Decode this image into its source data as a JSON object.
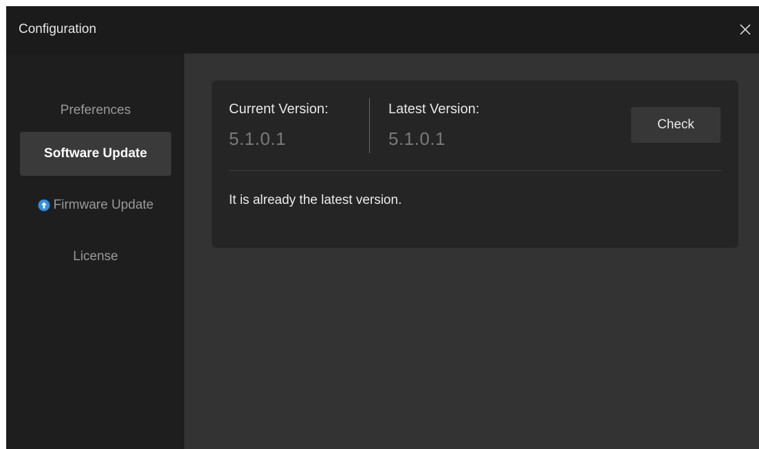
{
  "window": {
    "title": "Configuration"
  },
  "sidebar": {
    "items": [
      {
        "label": "Preferences",
        "active": false
      },
      {
        "label": "Software Update",
        "active": true
      },
      {
        "label": "Firmware Update",
        "active": false,
        "icon": "arrow-up-circle-icon"
      },
      {
        "label": "License",
        "active": false
      }
    ]
  },
  "update": {
    "current_label": "Current Version:",
    "current_value": "5.1.0.1",
    "latest_label": "Latest Version:",
    "latest_value": "5.1.0.1",
    "check_label": "Check",
    "status_text": "It is already the latest version."
  },
  "colors": {
    "accent": "#2f8fe0",
    "sidebar_active_bg": "#3a3a3a",
    "main_bg": "#333333",
    "card_bg": "#252525"
  }
}
